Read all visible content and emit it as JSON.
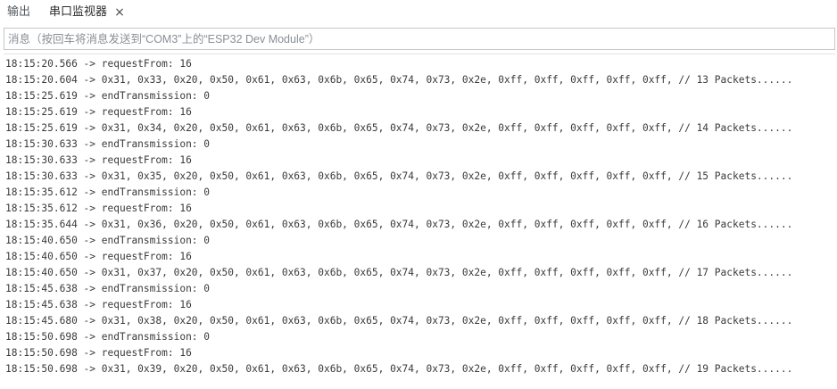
{
  "tabs": {
    "output_label": "输出",
    "serial_monitor_label": "串口监视器",
    "close_glyph": "×"
  },
  "message_input": {
    "placeholder": "消息（按回车将消息发送到“COM3”上的“ESP32 Dev Module”）",
    "value": ""
  },
  "log_lines": [
    "18:15:20.566 -> requestFrom: 16",
    "18:15:20.604 -> 0x31, 0x33, 0x20, 0x50, 0x61, 0x63, 0x6b, 0x65, 0x74, 0x73, 0x2e, 0xff, 0xff, 0xff, 0xff, 0xff, // 13 Packets......",
    "18:15:25.619 -> endTransmission: 0",
    "18:15:25.619 -> requestFrom: 16",
    "18:15:25.619 -> 0x31, 0x34, 0x20, 0x50, 0x61, 0x63, 0x6b, 0x65, 0x74, 0x73, 0x2e, 0xff, 0xff, 0xff, 0xff, 0xff, // 14 Packets......",
    "18:15:30.633 -> endTransmission: 0",
    "18:15:30.633 -> requestFrom: 16",
    "18:15:30.633 -> 0x31, 0x35, 0x20, 0x50, 0x61, 0x63, 0x6b, 0x65, 0x74, 0x73, 0x2e, 0xff, 0xff, 0xff, 0xff, 0xff, // 15 Packets......",
    "18:15:35.612 -> endTransmission: 0",
    "18:15:35.612 -> requestFrom: 16",
    "18:15:35.644 -> 0x31, 0x36, 0x20, 0x50, 0x61, 0x63, 0x6b, 0x65, 0x74, 0x73, 0x2e, 0xff, 0xff, 0xff, 0xff, 0xff, // 16 Packets......",
    "18:15:40.650 -> endTransmission: 0",
    "18:15:40.650 -> requestFrom: 16",
    "18:15:40.650 -> 0x31, 0x37, 0x20, 0x50, 0x61, 0x63, 0x6b, 0x65, 0x74, 0x73, 0x2e, 0xff, 0xff, 0xff, 0xff, 0xff, // 17 Packets......",
    "18:15:45.638 -> endTransmission: 0",
    "18:15:45.638 -> requestFrom: 16",
    "18:15:45.680 -> 0x31, 0x38, 0x20, 0x50, 0x61, 0x63, 0x6b, 0x65, 0x74, 0x73, 0x2e, 0xff, 0xff, 0xff, 0xff, 0xff, // 18 Packets......",
    "18:15:50.698 -> endTransmission: 0",
    "18:15:50.698 -> requestFrom: 16",
    "18:15:50.698 -> 0x31, 0x39, 0x20, 0x50, 0x61, 0x63, 0x6b, 0x65, 0x74, 0x73, 0x2e, 0xff, 0xff, 0xff, 0xff, 0xff, // 19 Packets......"
  ]
}
